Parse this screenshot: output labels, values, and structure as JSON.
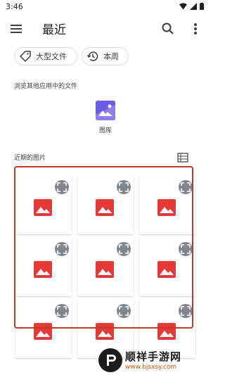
{
  "status_bar": {
    "time": "3:46"
  },
  "app_bar": {
    "title": "最近"
  },
  "chips": [
    {
      "label": "大型文件",
      "icon": "tag-icon"
    },
    {
      "label": "本周",
      "icon": "history-icon"
    }
  ],
  "browse_section": {
    "title": "浏览其他应用中的文件",
    "apps": [
      {
        "label": "图库",
        "icon": "gallery-icon"
      }
    ]
  },
  "recent_section": {
    "title": "近期的图片",
    "view_icon": "list-view-icon"
  },
  "image_grid": {
    "rows": 3,
    "columns": 3,
    "tile_icon": "image-placeholder-icon",
    "overlay_icon": "expand-icon"
  },
  "watermark": {
    "main": "顺祥手游网",
    "url": "www.bjsxsy.com"
  },
  "colors": {
    "image_icon": "#e53935",
    "highlight_border": "#c0392b",
    "gallery_icon": "#6c5ce7"
  }
}
